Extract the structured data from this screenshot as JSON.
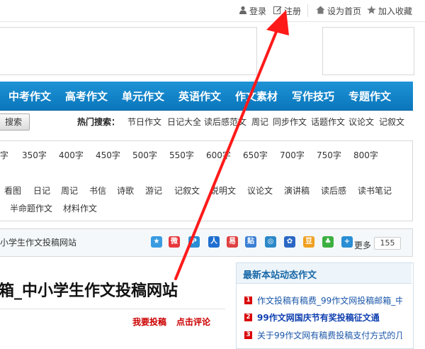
{
  "topbar": {
    "login": "登录",
    "register": "注册",
    "homepage": "设为首页",
    "favorite": "加入收藏"
  },
  "nav": {
    "items": [
      "中考作文",
      "高考作文",
      "单元作文",
      "英语作文",
      "作文素材",
      "写作技巧",
      "专题作文"
    ]
  },
  "search": {
    "button": "搜索",
    "hot_label": "热门搜索：",
    "hot_terms": [
      "节日作文",
      "日记大全",
      "读后感范文",
      "周记",
      "同步作文",
      "话题作文",
      "议论文",
      "记叙文"
    ]
  },
  "categories": {
    "word_counts": [
      "字",
      "350字",
      "400字",
      "450字",
      "500字",
      "550字",
      "600字",
      "650字",
      "700字",
      "750字",
      "800字"
    ],
    "genres": [
      "看图",
      "日记",
      "周记",
      "书信",
      "诗歌",
      "游记",
      "记叙文",
      "说明文",
      "议论文",
      "演讲稿",
      "读后感",
      "读书笔记"
    ],
    "extra": [
      "半命题作文",
      "材料作文"
    ]
  },
  "share": {
    "site_name": "小学生作文投稿网站",
    "more": "更多",
    "count": "155"
  },
  "article": {
    "title": "箱_中小学生作文投稿网站",
    "submit": "我要投稿",
    "comment": "点击评论"
  },
  "sidebar": {
    "title": "最新本站动态作文",
    "items": [
      {
        "num": "1",
        "text": "作文投稿有稿费_99作文网投稿邮箱_中",
        "bold": false
      },
      {
        "num": "2",
        "text": "99作文网国庆节有奖投稿征文通",
        "bold": true
      },
      {
        "num": "3",
        "text": "关于99作文网有稿费投稿支付方式的几",
        "bold": false
      }
    ]
  },
  "colors": {
    "nav_blue": "#0a76bc",
    "accent_red": "#cc0000",
    "annotation_arrow": "#ff1a1a"
  }
}
